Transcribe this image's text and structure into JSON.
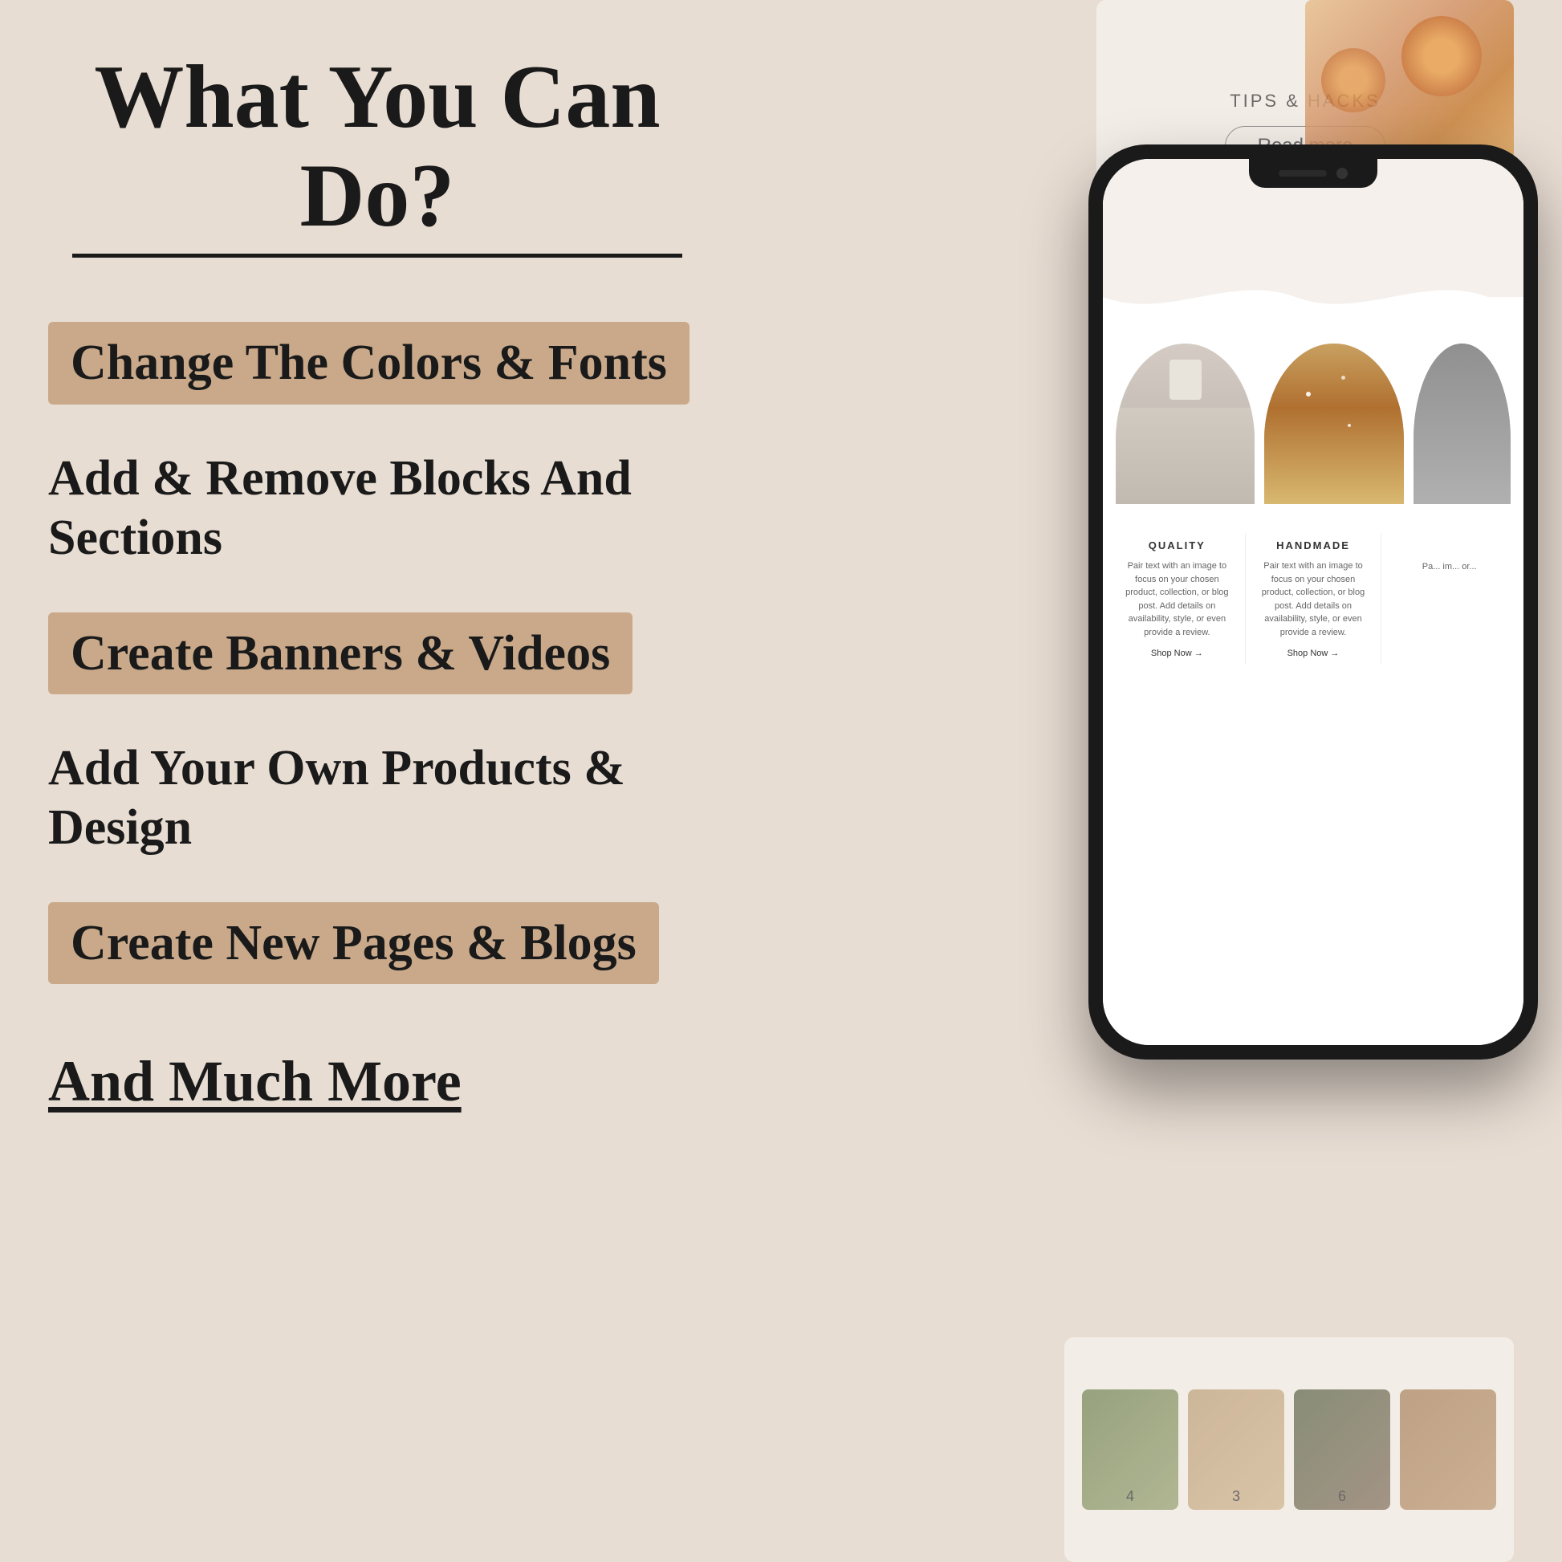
{
  "page": {
    "background_color": "#e8ddd3"
  },
  "header": {
    "title": "What You Can Do?"
  },
  "features": [
    {
      "id": "colors-fonts",
      "text": "Change The Colors & Fonts",
      "highlighted": true
    },
    {
      "id": "blocks-sections",
      "text": "Add & Remove Blocks And Sections",
      "highlighted": false
    },
    {
      "id": "banners-videos",
      "text": "Create Banners & Videos",
      "highlighted": true
    },
    {
      "id": "products-design",
      "text": "Add Your Own Products & Design",
      "highlighted": false
    },
    {
      "id": "pages-blogs",
      "text": "Create New Pages & Blogs",
      "highlighted": true
    }
  ],
  "cta": {
    "text": "And Much More"
  },
  "phone_screen": {
    "tips_label": "TIPS & HACKS",
    "read_more": "Read more",
    "quality_label": "QUALITY",
    "handmade_label": "HANDMADE",
    "product_desc_1": "Pair text with an image to focus on your chosen product, collection, or blog post. Add details on availability, style, or even provide a review.",
    "product_desc_2": "Pair text with an image to focus on your chosen product, collection, or blog post. Add details on availability, style, or even provide a review.",
    "shop_now_1": "Shop Now →",
    "shop_now_2": "Shop Now →",
    "on_your_chosen": "on Your chosen",
    "thumb_labels": [
      "4",
      "3",
      "6"
    ]
  }
}
